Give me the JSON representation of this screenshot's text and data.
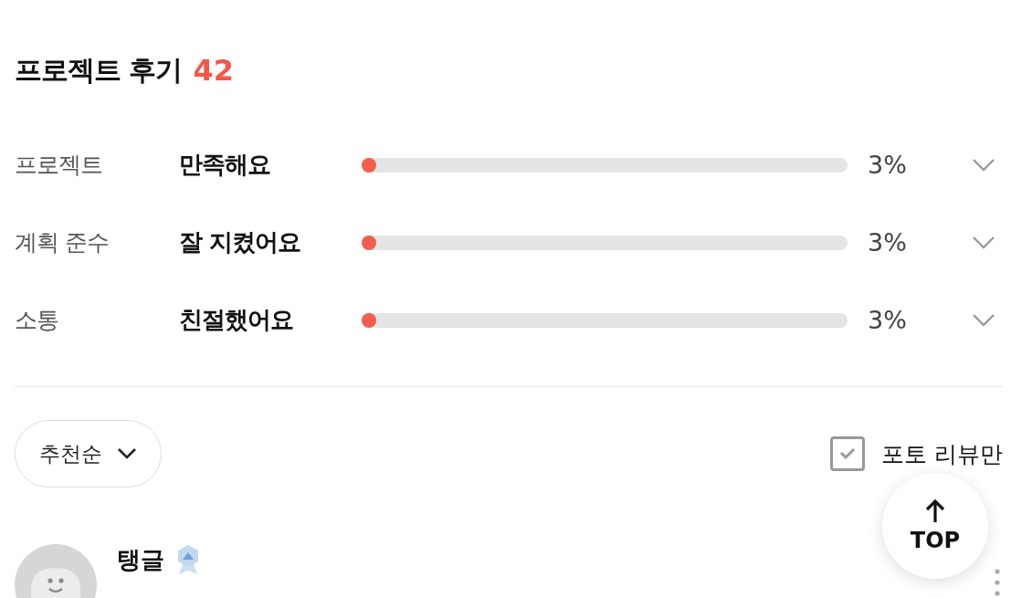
{
  "header": {
    "title": "프로젝트 후기",
    "count": "42"
  },
  "ratings": [
    {
      "category": "프로젝트",
      "answer": "만족해요",
      "level": 0.03,
      "reading": "3%",
      "expanded": false
    },
    {
      "category": "계획 준수",
      "answer": "잘 지켰어요",
      "level": 0.03,
      "reading": "3%",
      "expanded": false
    },
    {
      "category": "소통",
      "answer": "친절했어요",
      "level": 0.03,
      "reading": "3%",
      "expanded": false
    }
  ],
  "sort": {
    "label": "추천순"
  },
  "photo_filter": {
    "label": "포토 리뷰만",
    "checked": true
  },
  "top_button": {
    "label": "TOP"
  },
  "reviews": [
    {
      "author": "탱글"
    }
  ]
}
